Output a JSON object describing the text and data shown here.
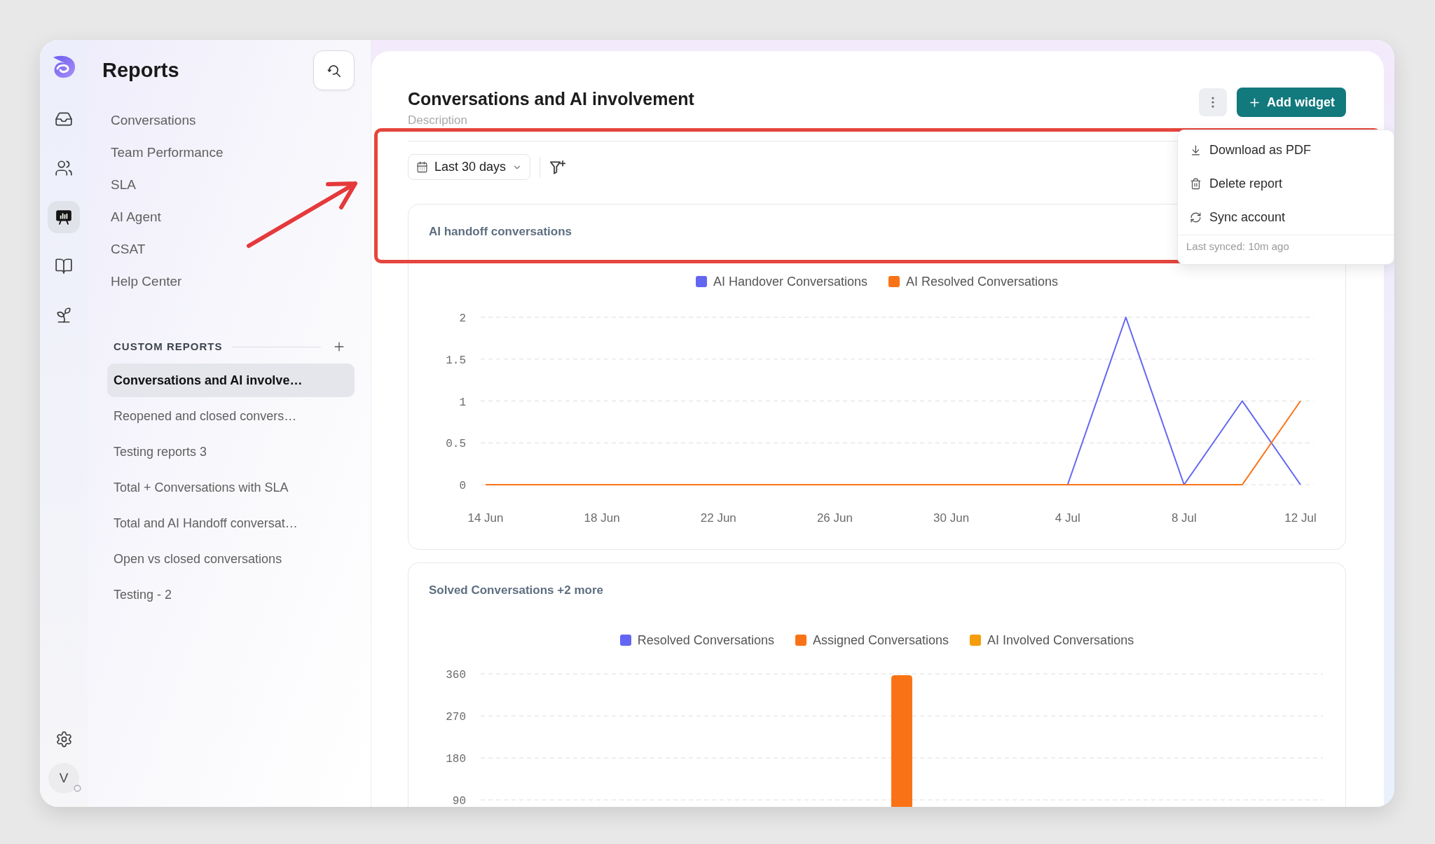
{
  "rail": {
    "items": [
      {
        "selected": false
      },
      {
        "selected": false
      },
      {
        "selected": true
      },
      {
        "selected": false
      },
      {
        "selected": false
      }
    ]
  },
  "user": {
    "initial": "V"
  },
  "sidebar": {
    "title": "Reports",
    "nav": [
      {
        "label": "Conversations",
        "selected": false
      },
      {
        "label": "Team Performance",
        "selected": false
      },
      {
        "label": "SLA",
        "selected": false
      },
      {
        "label": "AI Agent",
        "selected": false
      },
      {
        "label": "CSAT",
        "selected": false
      },
      {
        "label": "Help Center",
        "selected": false
      }
    ],
    "custom_reports": {
      "heading": "CUSTOM REPORTS",
      "items": [
        {
          "label": "Conversations and AI involve…",
          "selected": true
        },
        {
          "label": "Reopened and closed convers…",
          "selected": false
        },
        {
          "label": "Testing reports 3",
          "selected": false
        },
        {
          "label": "Total + Conversations with SLA",
          "selected": false
        },
        {
          "label": "Total and AI Handoff conversat…",
          "selected": false
        },
        {
          "label": "Open vs closed conversations",
          "selected": false
        },
        {
          "label": "Testing - 2",
          "selected": false
        }
      ]
    }
  },
  "report": {
    "title": "Conversations and AI involvement",
    "description": "Description",
    "add_widget": "Add widget",
    "date_range": "Last 30 days"
  },
  "menu": {
    "items": [
      {
        "label": "Download as PDF"
      },
      {
        "label": "Delete report"
      },
      {
        "label": "Sync account"
      }
    ],
    "footer": "Last synced: 10m ago"
  },
  "widgets": [
    {
      "title": "AI handoff conversations",
      "chart_data": {
        "type": "line",
        "legend": "top",
        "grid": true,
        "categories": [
          "14 Jun",
          null,
          "18 Jun",
          null,
          "22 Jun",
          null,
          "26 Jun",
          null,
          "30 Jun",
          null,
          "4 Jul",
          null,
          "8 Jul",
          null,
          "12 Jul"
        ],
        "ylim": [
          0,
          2
        ],
        "yticks": [
          0,
          0.5,
          1,
          1.5,
          2
        ],
        "series": [
          {
            "name": "AI Handover Conversations",
            "color": "#6366f1",
            "values": [
              null,
              null,
              null,
              null,
              null,
              null,
              null,
              null,
              null,
              null,
              0,
              2,
              0,
              1,
              0
            ]
          },
          {
            "name": "AI Resolved Conversations",
            "color": "#f97316",
            "values": [
              0,
              0,
              0,
              0,
              0,
              0,
              0,
              0,
              0,
              0,
              0,
              0,
              0,
              0,
              1
            ]
          }
        ]
      }
    },
    {
      "title": "Solved Conversations +2 more",
      "chart_data": {
        "type": "bar",
        "legend": "top",
        "grid": true,
        "categories": [
          null
        ],
        "ylim": [
          69,
          360
        ],
        "yticks": [
          90,
          180,
          270,
          360
        ],
        "series": [
          {
            "name": "Resolved Conversations",
            "color": "#6366f1",
            "values": [
              null
            ]
          },
          {
            "name": "Assigned Conversations",
            "color": "#f97316",
            "values": [
              357
            ]
          },
          {
            "name": "AI Involved Conversations",
            "color": "#f59e0b",
            "values": [
              null
            ]
          }
        ]
      }
    }
  ]
}
